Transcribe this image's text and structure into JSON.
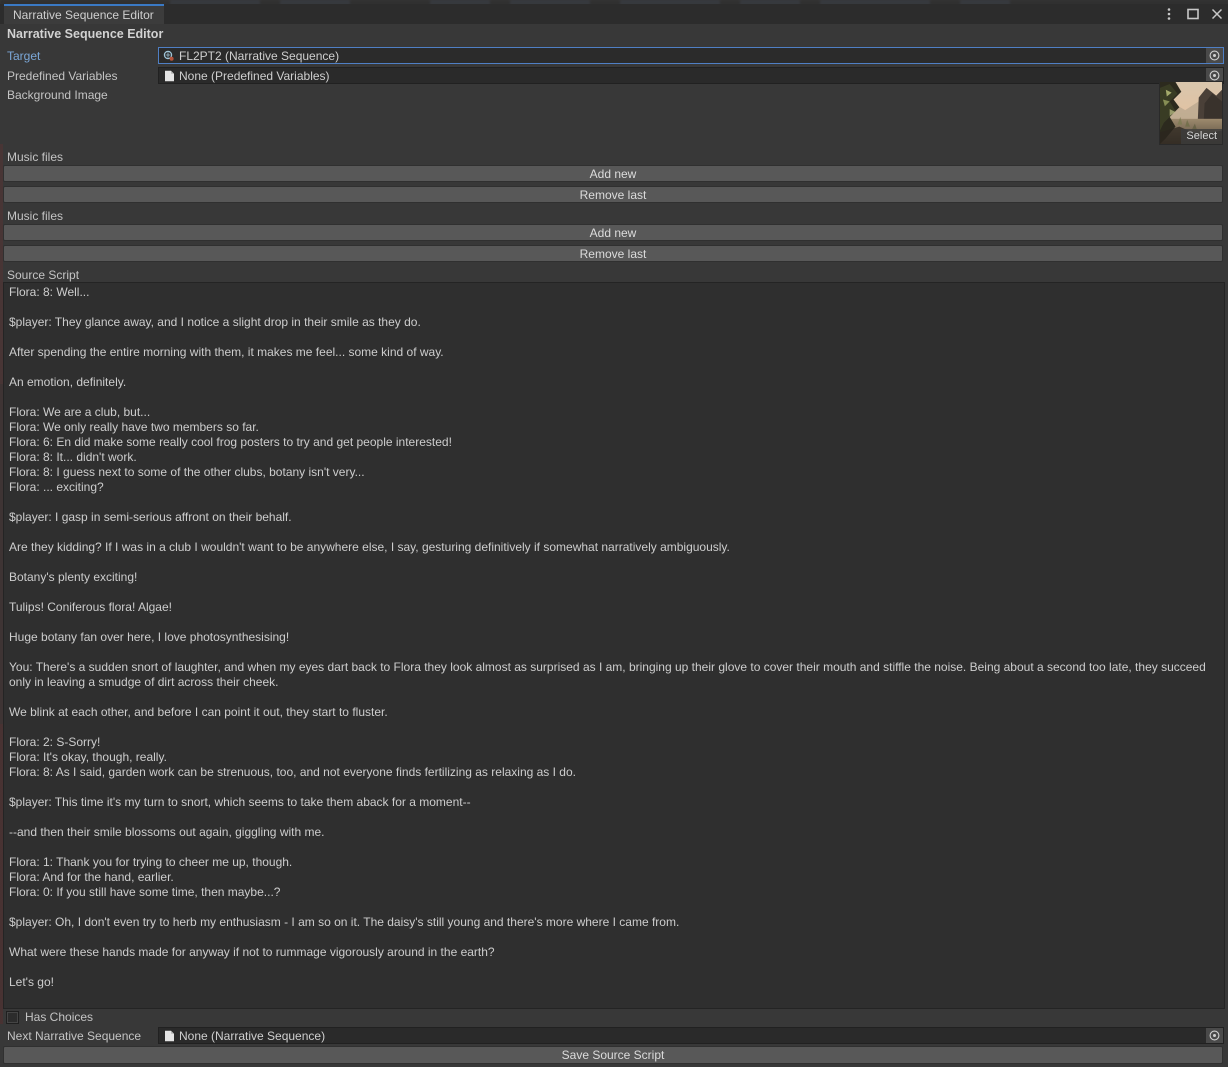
{
  "window": {
    "tab_label": "Narrative Sequence Editor",
    "controls": [
      {
        "name": "more-options",
        "glyph": "kebab"
      },
      {
        "name": "maximize",
        "glyph": "square"
      },
      {
        "name": "close",
        "glyph": "x"
      }
    ]
  },
  "inspector": {
    "header_title": "Narrative Sequence Editor",
    "fields": [
      {
        "label": "Target",
        "value": "FL2PT2 (Narrative Sequence)",
        "icon": "narrative-sequence-asset-icon",
        "focused": true,
        "picker": "object-picker-icon"
      },
      {
        "label": "Predefined Variables",
        "value": "None (Predefined Variables)",
        "icon": "script-asset-icon",
        "focused": false,
        "picker": "object-picker-icon"
      }
    ],
    "background_image": {
      "label": "Background Image",
      "select_label": "Select"
    },
    "music_sections": [
      {
        "label": "Music files",
        "add_label": "Add new",
        "remove_label": "Remove last"
      },
      {
        "label": "Music files",
        "add_label": "Add new",
        "remove_label": "Remove last"
      }
    ],
    "source_script": {
      "label": "Source Script",
      "lines": [
        "Flora: 8: Well...",
        "",
        "$player: They glance away, and I notice a slight drop in their smile as they do.",
        "",
        "After spending the entire morning with them, it makes me feel... some kind of way.",
        "",
        "An emotion, definitely.",
        "",
        "Flora: We are a club, but...",
        "Flora: We only really have two members so far.",
        "Flora: 6: En did make some really cool frog posters to try and get people interested!",
        "Flora: 8: It... didn't work.",
        "Flora: 8: I guess next to some of the other clubs, botany isn't very...",
        "Flora: ... exciting?",
        "",
        "$player: I gasp in semi-serious affront on their behalf.",
        "",
        "Are they kidding? If I was in a club I wouldn't want to be anywhere else, I say, gesturing definitively if somewhat narratively ambiguously.",
        "",
        "Botany's plenty exciting!",
        "",
        "Tulips! Coniferous flora! Algae!",
        "",
        "Huge botany fan over here, I love photosynthesising!",
        "",
        "You: There's a sudden snort of laughter, and when my eyes dart back to Flora they look almost as surprised as I am, bringing up their glove to cover their mouth and stiffle the noise. Being about a second too late, they succeed only in leaving a smudge of dirt across their cheek.",
        "",
        "We blink at each other, and before I can point it out, they start to fluster.",
        "",
        "Flora: 2: S-Sorry!",
        "Flora: It's okay, though, really.",
        "Flora: 8: As I said, garden work can be strenuous, too, and not everyone finds fertilizing as relaxing as I do.",
        "",
        "$player: This time it's my turn to snort, which seems to take them aback for a moment--",
        "",
        "--and then their smile blossoms out again, giggling with me.",
        "",
        "Flora: 1: Thank you for trying to cheer me up, though.",
        "Flora: And for the hand, earlier.",
        "Flora: 0: If you still have some time, then maybe...?",
        "",
        "$player: Oh, I don't even try to herb my enthusiasm - I am so on it. The daisy's still young and there's more where I came from.",
        "",
        "What were these hands made for anyway if not to rummage vigorously around in the earth?",
        "",
        "Let's go!"
      ]
    },
    "has_choices": {
      "label": "Has Choices",
      "checked": false
    },
    "next_sequence": {
      "label": "Next Narrative Sequence",
      "value": "None (Narrative Sequence)",
      "icon": "script-asset-icon",
      "picker": "object-picker-icon"
    },
    "save_button_label": "Save Source Script"
  },
  "colors": {
    "window_bg": "#383838",
    "panel_bg": "#2c2c2c",
    "tab_active_accent": "#3a79c4",
    "field_bg": "#2a2a2a",
    "button_bg": "#585858",
    "label_accent": "#7ba7d7",
    "text": "#c4c4c4"
  }
}
